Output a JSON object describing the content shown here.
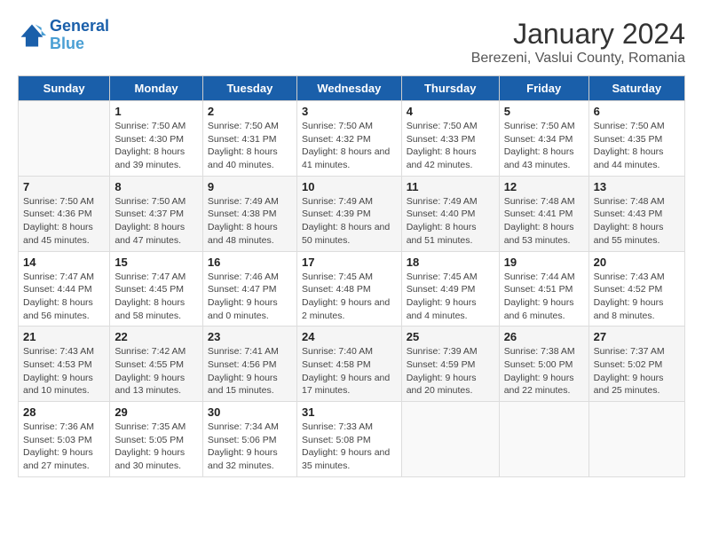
{
  "logo": {
    "line1": "General",
    "line2": "Blue"
  },
  "title": "January 2024",
  "subtitle": "Berezeni, Vaslui County, Romania",
  "weekdays": [
    "Sunday",
    "Monday",
    "Tuesday",
    "Wednesday",
    "Thursday",
    "Friday",
    "Saturday"
  ],
  "weeks": [
    [
      {
        "day": "",
        "sunrise": "",
        "sunset": "",
        "daylight": ""
      },
      {
        "day": "1",
        "sunrise": "Sunrise: 7:50 AM",
        "sunset": "Sunset: 4:30 PM",
        "daylight": "Daylight: 8 hours and 39 minutes."
      },
      {
        "day": "2",
        "sunrise": "Sunrise: 7:50 AM",
        "sunset": "Sunset: 4:31 PM",
        "daylight": "Daylight: 8 hours and 40 minutes."
      },
      {
        "day": "3",
        "sunrise": "Sunrise: 7:50 AM",
        "sunset": "Sunset: 4:32 PM",
        "daylight": "Daylight: 8 hours and 41 minutes."
      },
      {
        "day": "4",
        "sunrise": "Sunrise: 7:50 AM",
        "sunset": "Sunset: 4:33 PM",
        "daylight": "Daylight: 8 hours and 42 minutes."
      },
      {
        "day": "5",
        "sunrise": "Sunrise: 7:50 AM",
        "sunset": "Sunset: 4:34 PM",
        "daylight": "Daylight: 8 hours and 43 minutes."
      },
      {
        "day": "6",
        "sunrise": "Sunrise: 7:50 AM",
        "sunset": "Sunset: 4:35 PM",
        "daylight": "Daylight: 8 hours and 44 minutes."
      }
    ],
    [
      {
        "day": "7",
        "sunrise": "Sunrise: 7:50 AM",
        "sunset": "Sunset: 4:36 PM",
        "daylight": "Daylight: 8 hours and 45 minutes."
      },
      {
        "day": "8",
        "sunrise": "Sunrise: 7:50 AM",
        "sunset": "Sunset: 4:37 PM",
        "daylight": "Daylight: 8 hours and 47 minutes."
      },
      {
        "day": "9",
        "sunrise": "Sunrise: 7:49 AM",
        "sunset": "Sunset: 4:38 PM",
        "daylight": "Daylight: 8 hours and 48 minutes."
      },
      {
        "day": "10",
        "sunrise": "Sunrise: 7:49 AM",
        "sunset": "Sunset: 4:39 PM",
        "daylight": "Daylight: 8 hours and 50 minutes."
      },
      {
        "day": "11",
        "sunrise": "Sunrise: 7:49 AM",
        "sunset": "Sunset: 4:40 PM",
        "daylight": "Daylight: 8 hours and 51 minutes."
      },
      {
        "day": "12",
        "sunrise": "Sunrise: 7:48 AM",
        "sunset": "Sunset: 4:41 PM",
        "daylight": "Daylight: 8 hours and 53 minutes."
      },
      {
        "day": "13",
        "sunrise": "Sunrise: 7:48 AM",
        "sunset": "Sunset: 4:43 PM",
        "daylight": "Daylight: 8 hours and 55 minutes."
      }
    ],
    [
      {
        "day": "14",
        "sunrise": "Sunrise: 7:47 AM",
        "sunset": "Sunset: 4:44 PM",
        "daylight": "Daylight: 8 hours and 56 minutes."
      },
      {
        "day": "15",
        "sunrise": "Sunrise: 7:47 AM",
        "sunset": "Sunset: 4:45 PM",
        "daylight": "Daylight: 8 hours and 58 minutes."
      },
      {
        "day": "16",
        "sunrise": "Sunrise: 7:46 AM",
        "sunset": "Sunset: 4:47 PM",
        "daylight": "Daylight: 9 hours and 0 minutes."
      },
      {
        "day": "17",
        "sunrise": "Sunrise: 7:45 AM",
        "sunset": "Sunset: 4:48 PM",
        "daylight": "Daylight: 9 hours and 2 minutes."
      },
      {
        "day": "18",
        "sunrise": "Sunrise: 7:45 AM",
        "sunset": "Sunset: 4:49 PM",
        "daylight": "Daylight: 9 hours and 4 minutes."
      },
      {
        "day": "19",
        "sunrise": "Sunrise: 7:44 AM",
        "sunset": "Sunset: 4:51 PM",
        "daylight": "Daylight: 9 hours and 6 minutes."
      },
      {
        "day": "20",
        "sunrise": "Sunrise: 7:43 AM",
        "sunset": "Sunset: 4:52 PM",
        "daylight": "Daylight: 9 hours and 8 minutes."
      }
    ],
    [
      {
        "day": "21",
        "sunrise": "Sunrise: 7:43 AM",
        "sunset": "Sunset: 4:53 PM",
        "daylight": "Daylight: 9 hours and 10 minutes."
      },
      {
        "day": "22",
        "sunrise": "Sunrise: 7:42 AM",
        "sunset": "Sunset: 4:55 PM",
        "daylight": "Daylight: 9 hours and 13 minutes."
      },
      {
        "day": "23",
        "sunrise": "Sunrise: 7:41 AM",
        "sunset": "Sunset: 4:56 PM",
        "daylight": "Daylight: 9 hours and 15 minutes."
      },
      {
        "day": "24",
        "sunrise": "Sunrise: 7:40 AM",
        "sunset": "Sunset: 4:58 PM",
        "daylight": "Daylight: 9 hours and 17 minutes."
      },
      {
        "day": "25",
        "sunrise": "Sunrise: 7:39 AM",
        "sunset": "Sunset: 4:59 PM",
        "daylight": "Daylight: 9 hours and 20 minutes."
      },
      {
        "day": "26",
        "sunrise": "Sunrise: 7:38 AM",
        "sunset": "Sunset: 5:00 PM",
        "daylight": "Daylight: 9 hours and 22 minutes."
      },
      {
        "day": "27",
        "sunrise": "Sunrise: 7:37 AM",
        "sunset": "Sunset: 5:02 PM",
        "daylight": "Daylight: 9 hours and 25 minutes."
      }
    ],
    [
      {
        "day": "28",
        "sunrise": "Sunrise: 7:36 AM",
        "sunset": "Sunset: 5:03 PM",
        "daylight": "Daylight: 9 hours and 27 minutes."
      },
      {
        "day": "29",
        "sunrise": "Sunrise: 7:35 AM",
        "sunset": "Sunset: 5:05 PM",
        "daylight": "Daylight: 9 hours and 30 minutes."
      },
      {
        "day": "30",
        "sunrise": "Sunrise: 7:34 AM",
        "sunset": "Sunset: 5:06 PM",
        "daylight": "Daylight: 9 hours and 32 minutes."
      },
      {
        "day": "31",
        "sunrise": "Sunrise: 7:33 AM",
        "sunset": "Sunset: 5:08 PM",
        "daylight": "Daylight: 9 hours and 35 minutes."
      },
      {
        "day": "",
        "sunrise": "",
        "sunset": "",
        "daylight": ""
      },
      {
        "day": "",
        "sunrise": "",
        "sunset": "",
        "daylight": ""
      },
      {
        "day": "",
        "sunrise": "",
        "sunset": "",
        "daylight": ""
      }
    ]
  ]
}
